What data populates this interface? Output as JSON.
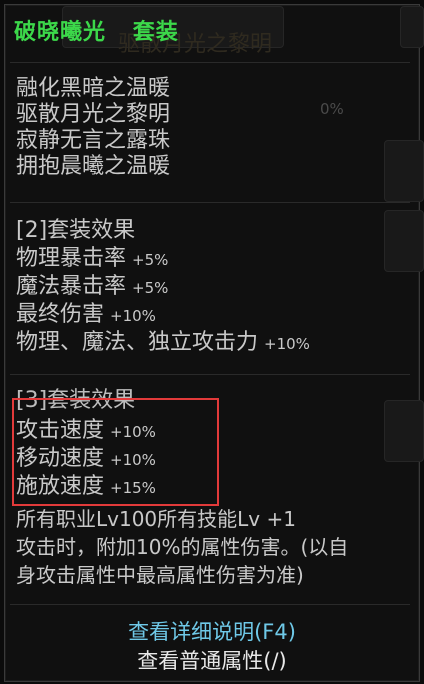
{
  "tooltip": {
    "title": "破晓曦光",
    "title_tag": "套装",
    "ghost_title": "驱散月光之黎明",
    "ghost_percent": "0%",
    "set_items": [
      "融化黑暗之温暖",
      "驱散月光之黎明",
      "寂静无言之露珠",
      "拥抱晨曦之温暖"
    ],
    "set2": {
      "header": "[2]套装效果",
      "effects": [
        {
          "name": "物理暴击率",
          "value": "+5%"
        },
        {
          "name": "魔法暴击率",
          "value": "+5%"
        },
        {
          "name": "最终伤害",
          "value": "+10%"
        },
        {
          "name": "物理、魔法、独立攻击力",
          "value": "+10%"
        }
      ]
    },
    "set3": {
      "header": "[3]套装效果",
      "effects": [
        {
          "name": "攻击速度",
          "value": "+10%"
        },
        {
          "name": "移动速度",
          "value": "+10%"
        },
        {
          "name": "施放速度",
          "value": "+15%"
        }
      ],
      "extra_lines": [
        "所有职业Lv100所有技能Lv +1",
        "攻击时，附加10%的属性伤害。(以自",
        "身攻击属性中最高属性伤害为准)"
      ]
    },
    "links": {
      "detail": "查看详细说明(F4)",
      "normal": "查看普通属性(/)"
    }
  },
  "colors": {
    "title_green": "#3cd84a",
    "text": "#c9c9c9",
    "link_blue": "#6fc9e8",
    "highlight_red": "#e23a3a"
  }
}
